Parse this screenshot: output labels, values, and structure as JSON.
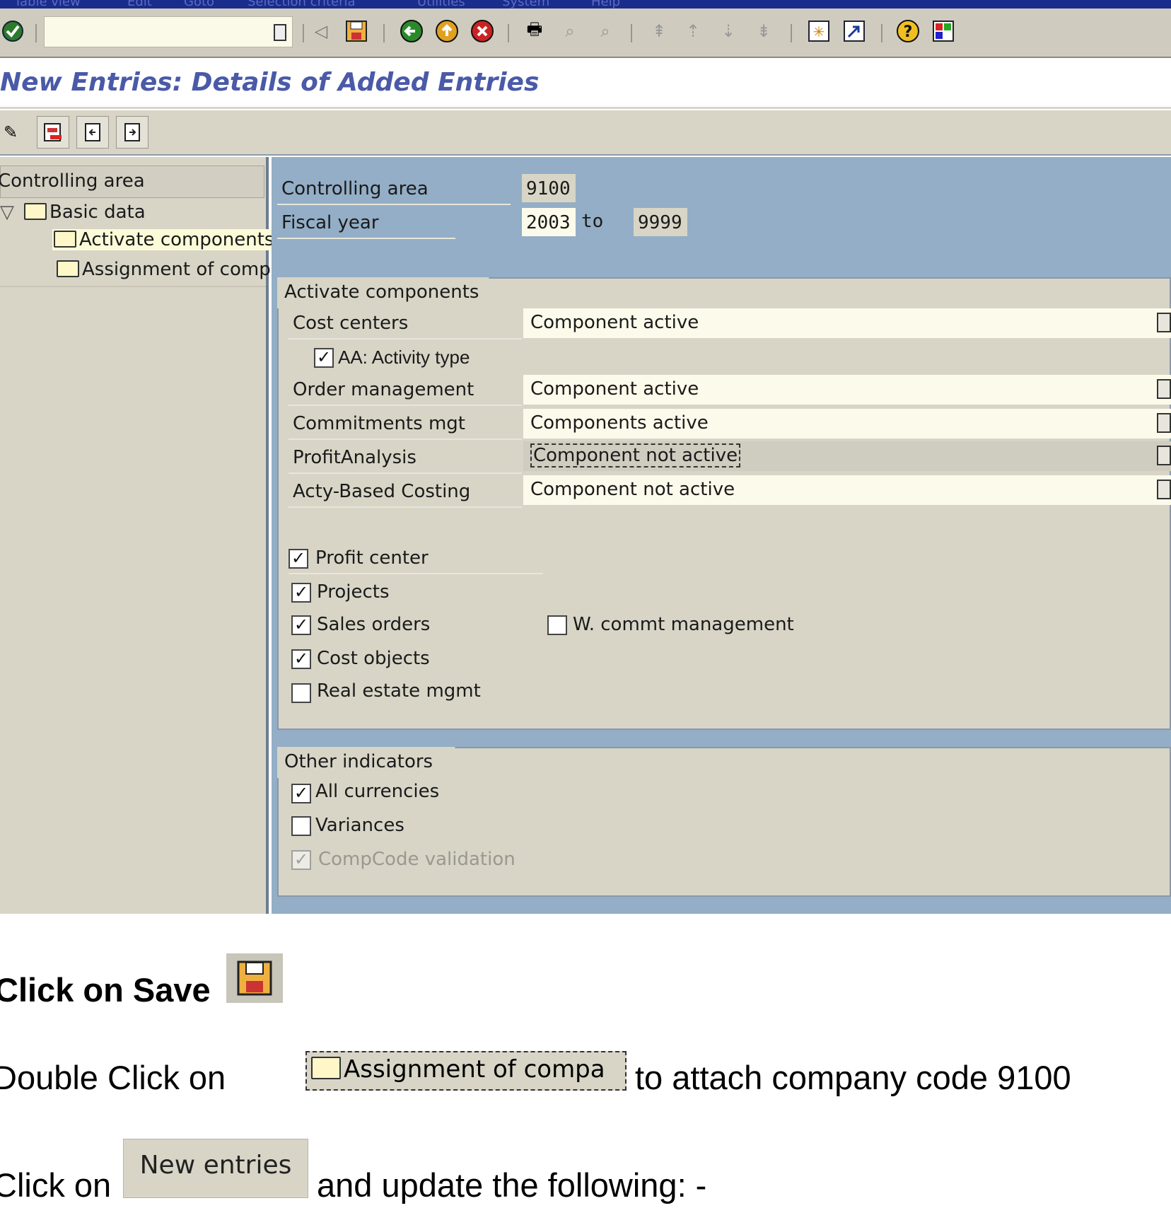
{
  "menu": [
    "Table view",
    "Edit",
    "Goto",
    "Selection criteria",
    "Utilities",
    "System",
    "Help"
  ],
  "title": "New Entries: Details of Added Entries",
  "tree": {
    "header": "Controlling area",
    "node_basic": "Basic data",
    "node_activate": "Activate components.",
    "node_assign": "Assignment of comp"
  },
  "header_fields": {
    "ctrl_area_label": "Controlling area",
    "ctrl_area_value": "9100",
    "fiscal_year_label": "Fiscal year",
    "fiscal_from": "2003",
    "to_label": "to",
    "fiscal_to": "9999"
  },
  "activate": {
    "title": "Activate components",
    "cost_centers_label": "Cost centers",
    "cost_centers_value": "Component active",
    "aa_label": "AA: Activity type",
    "order_label": "Order management",
    "order_value": "Component active",
    "commit_label": "Commitments mgt",
    "commit_value": "Components active",
    "profit_label": "ProfitAnalysis",
    "profit_value": "Component not active",
    "abc_label": "Acty-Based Costing",
    "abc_value": "Component not active",
    "cb_profit_center": "Profit center",
    "cb_projects": "Projects",
    "cb_sales_orders": "Sales orders",
    "cb_cost_objects": "Cost objects",
    "cb_real_estate": "Real estate mgmt",
    "cb_wcommt": "W. commt management"
  },
  "other": {
    "title": "Other indicators",
    "cb_all_curr": "All currencies",
    "cb_variances": "Variances",
    "cb_compcode": "CompCode validation"
  },
  "instructions": {
    "line1": "Click on Save",
    "line2_pre": "Double Click on",
    "line2_btn": "Assignment of compa",
    "line2_post": "to attach company code 9100",
    "line3_pre": "Click on",
    "line3_btn": "New entries",
    "line3_post": "and update the following: -"
  }
}
